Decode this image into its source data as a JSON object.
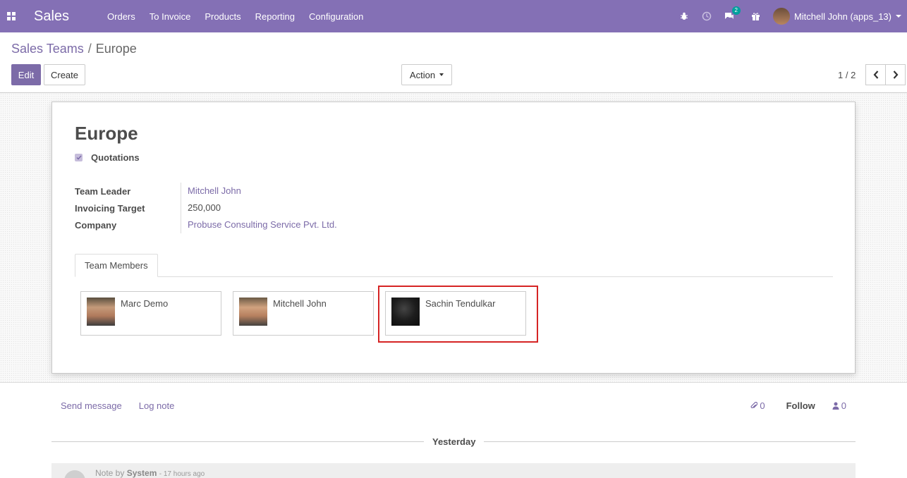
{
  "navbar": {
    "app_title": "Sales",
    "menu": [
      "Orders",
      "To Invoice",
      "Products",
      "Reporting",
      "Configuration"
    ],
    "chat_badge": "2",
    "user_name": "Mitchell John (apps_13)"
  },
  "breadcrumb": {
    "parent": "Sales Teams",
    "separator": "/",
    "current": "Europe"
  },
  "toolbar": {
    "edit": "Edit",
    "create": "Create",
    "action": "Action",
    "pager": "1 / 2"
  },
  "form": {
    "title": "Europe",
    "quotations_label": "Quotations",
    "fields": [
      {
        "label": "Team Leader",
        "value": "Mitchell John"
      },
      {
        "label": "Invoicing Target",
        "value": "250,000"
      },
      {
        "label": "Company",
        "value": "Probuse Consulting Service Pvt. Ltd."
      }
    ],
    "tab": "Team Members",
    "members": [
      "Marc Demo",
      "Mitchell John",
      "Sachin Tendulkar"
    ]
  },
  "chatter": {
    "send_message": "Send message",
    "log_note": "Log note",
    "attachments": "0",
    "follow": "Follow",
    "followers": "0",
    "date_separator": "Yesterday",
    "note_prefix": "Note by",
    "note_author": "System",
    "note_time": "- 17 hours ago"
  },
  "colors": {
    "navbar": "#8470b5",
    "primary": "#7c6ba8",
    "highlight": "#d62424"
  }
}
